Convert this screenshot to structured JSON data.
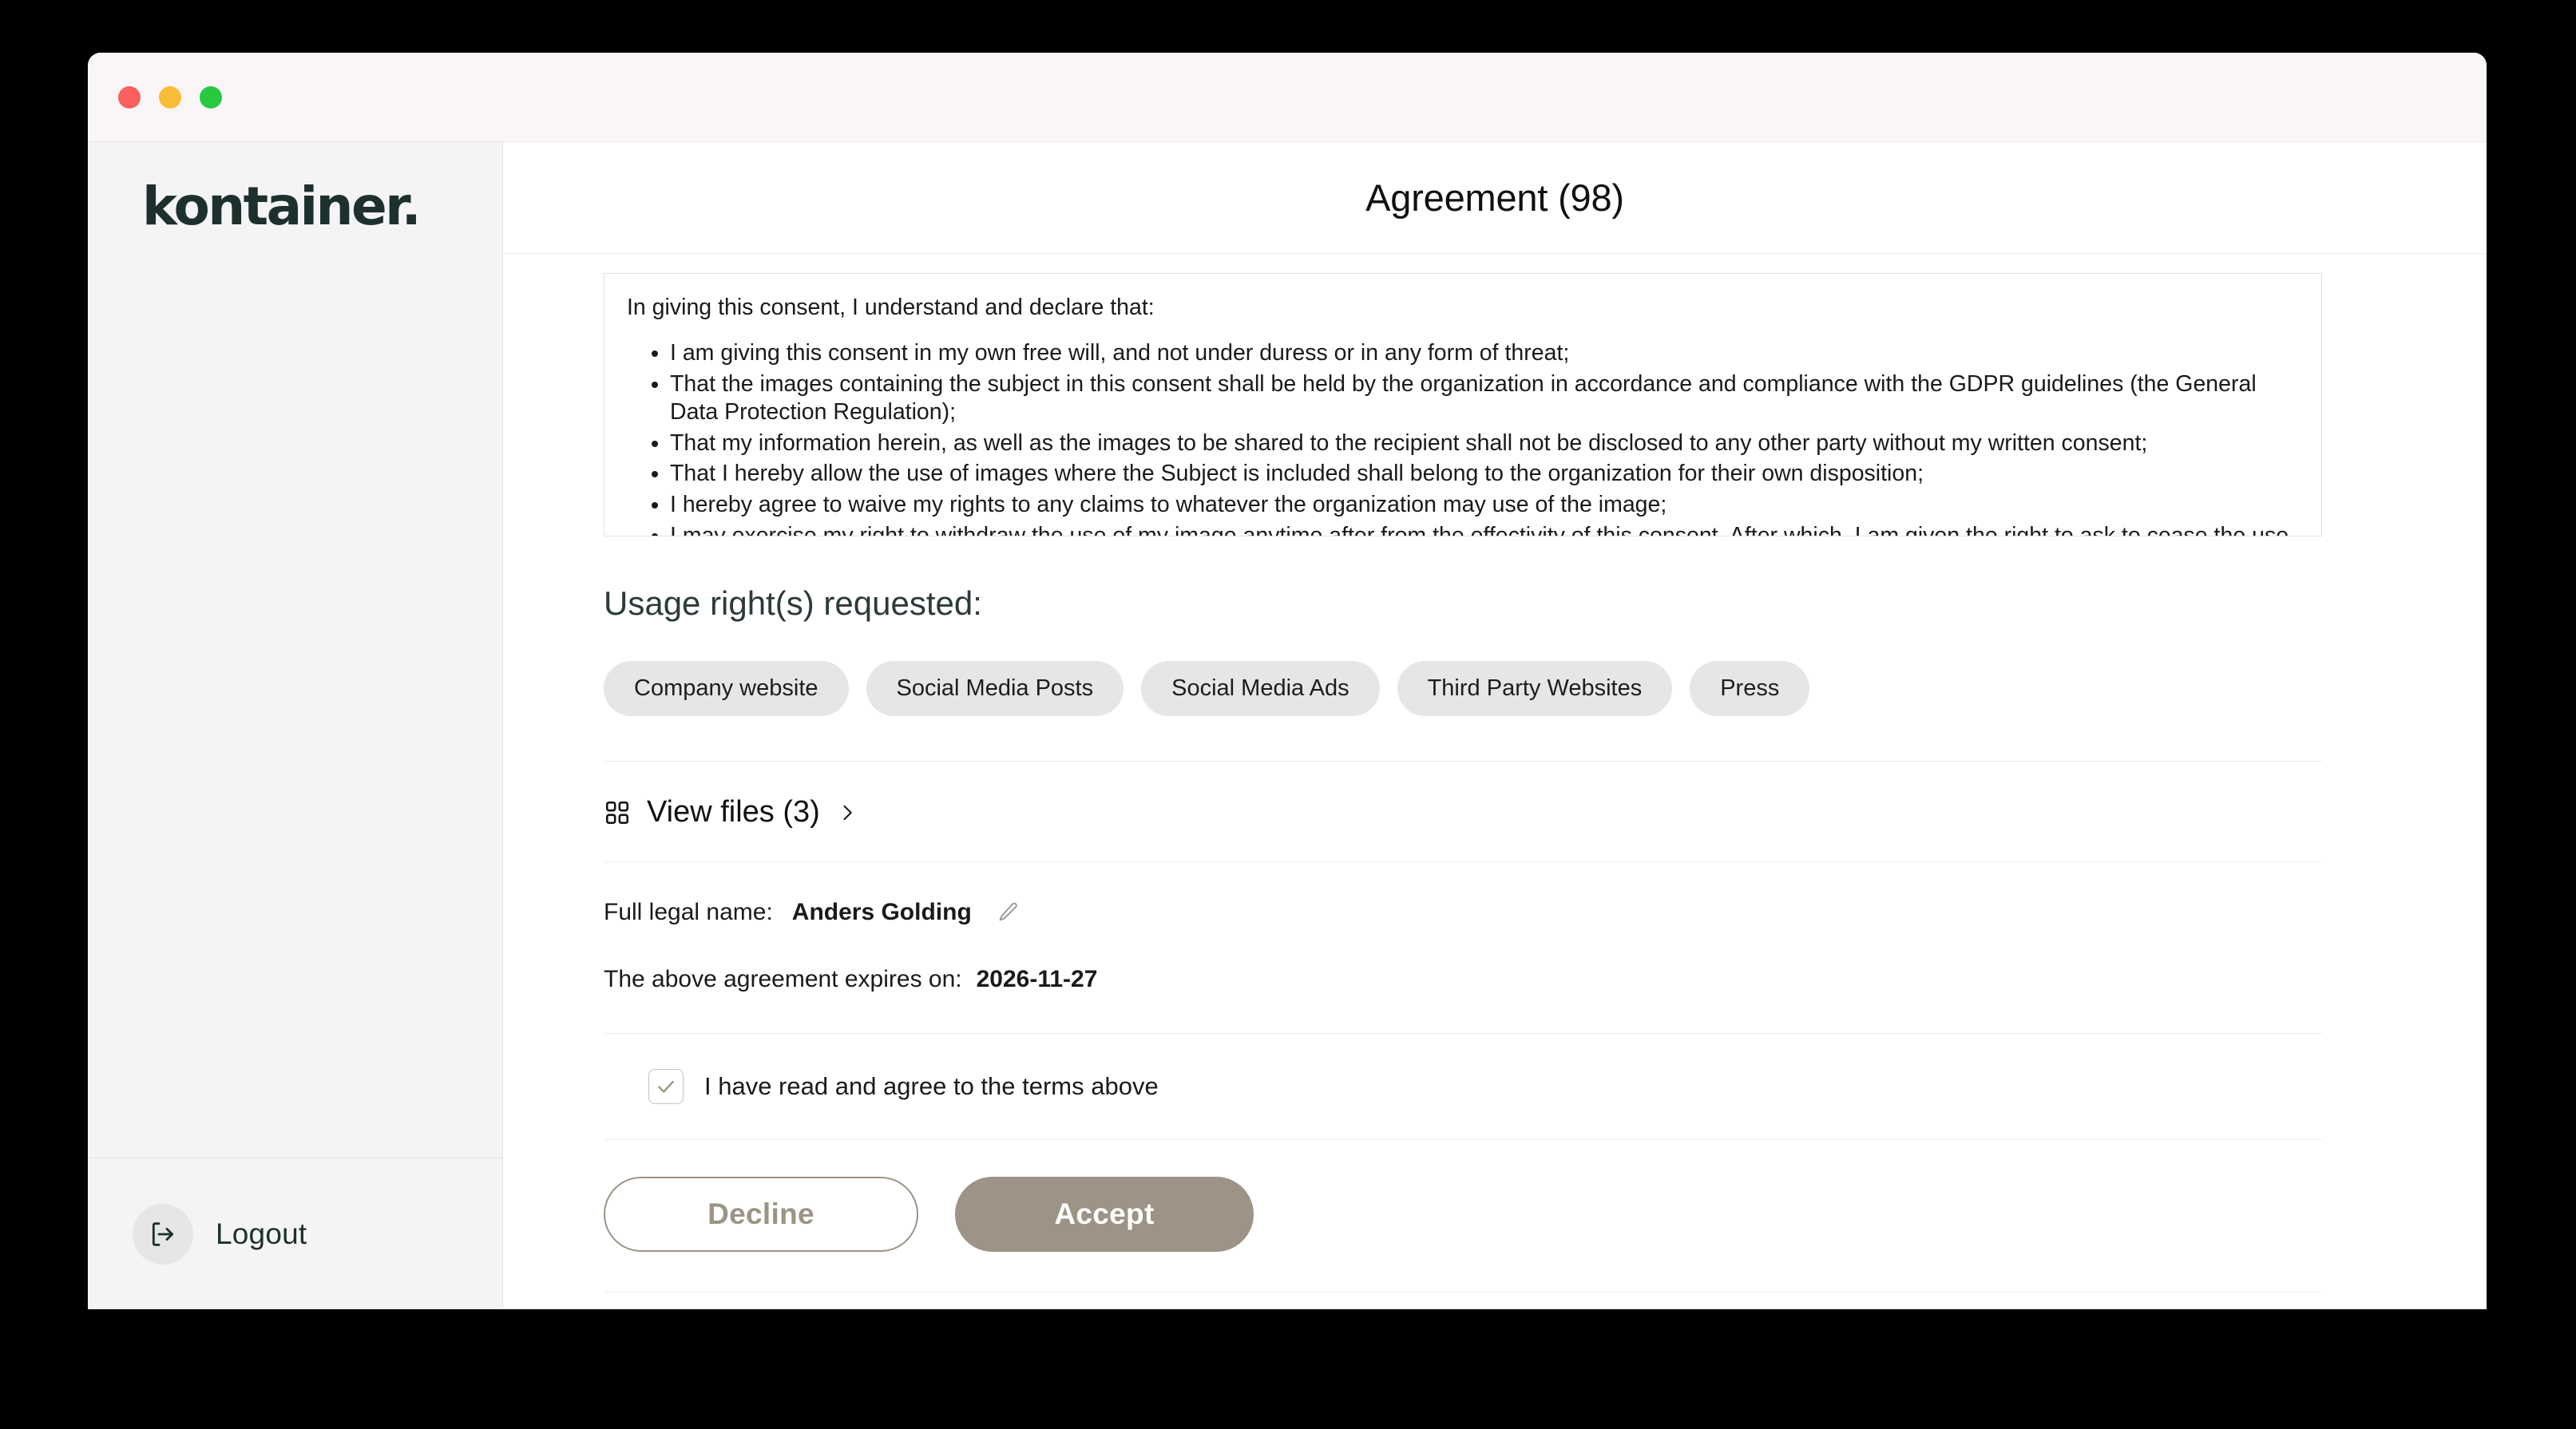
{
  "window": {
    "traffic_lights": [
      "close",
      "minimize",
      "maximize"
    ],
    "colors": {
      "close": "#f9605b",
      "minimize": "#f9bc36",
      "maximize": "#27c93f",
      "accent": "#9d9386",
      "heading": "#2b3b38",
      "titlebar_bg": "#faf6f8",
      "sidebar_bg": "#f4f4f4"
    }
  },
  "sidebar": {
    "logo": "kontainer.",
    "logout_label": "Logout"
  },
  "header": {
    "title": "Agreement (98)"
  },
  "terms": {
    "intro": "In giving this consent, I understand and declare that:",
    "bullets": [
      "I am giving this consent in my own free will, and not under duress or in any form of threat;",
      "That the images containing the subject in this consent shall be held by the organization in accordance and compliance with the GDPR guidelines (the General Data Protection Regulation);",
      "That my information herein, as well as the images to be shared to the recipient shall not be disclosed to any other party without my written consent;",
      "That I hereby allow the use of images where the Subject is included shall belong to the organization for their own disposition;",
      "I hereby agree to waive my rights to any claims to whatever the organization may use of the image;",
      "I may exercise my right to withdraw the use of my image anytime after from the effectivity of this consent. After which, I am given the right to ask to cease the use of my image anytime after."
    ]
  },
  "usage_rights": {
    "heading": "Usage right(s) requested:",
    "chips": [
      "Company website",
      "Social Media Posts",
      "Social Media Ads",
      "Third Party Websites",
      "Press"
    ]
  },
  "files": {
    "label": "View files (3)",
    "count": 3
  },
  "agreement": {
    "name_label": "Full legal name:",
    "name_value": "Anders Golding",
    "expiry_label": "The above agreement expires on:",
    "expiry_value": "2026-11-27"
  },
  "consent": {
    "checkbox_label": "I have read and agree to the terms above",
    "checked": true
  },
  "actions": {
    "decline_label": "Decline",
    "accept_label": "Accept"
  }
}
